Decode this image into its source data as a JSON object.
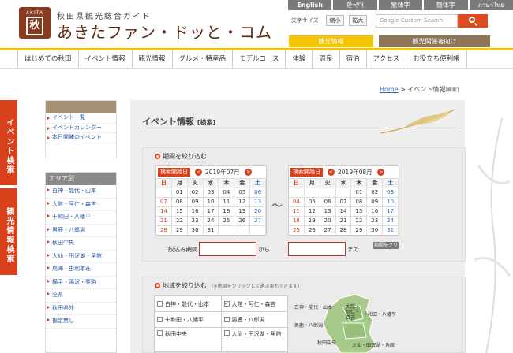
{
  "header": {
    "logo_text": "AKITA",
    "subtitle": "秋田県観光総合ガイド",
    "title": "あきたファン・ドッと・コム",
    "languages": [
      "English",
      "한국어",
      "繁体字",
      "簡体字",
      "ภาษาไทย"
    ],
    "font_size_label": "文字サイズ",
    "shrink_label": "縮小",
    "enlarge_label": "拡大",
    "search_placeholder": "Google Custom Search",
    "tab_tourism": "観光情報",
    "tab_business": "観光関係者向け"
  },
  "nav": {
    "items": [
      "はじめての秋田",
      "イベント情報",
      "観光情報",
      "グルメ・特産品",
      "モデルコース",
      "体験",
      "温泉",
      "宿泊",
      "アクセス",
      "お役立ち便利帳"
    ]
  },
  "breadcrumb": {
    "home": "Home",
    "sep": ">",
    "current": "イベント情報",
    "current_sub": "[検索]"
  },
  "side_tabs": {
    "event": "イベント検索",
    "sightseeing": "観光情報検索"
  },
  "sidebar": {
    "event_links": [
      "イベント一覧",
      "イベントカレンダー",
      "本日開催のイベント"
    ],
    "area_heading": "エリア別",
    "areas": [
      "白神・能代・山本",
      "大館・阿仁・森吉",
      "十和田・八幡平",
      "男鹿・八郎潟",
      "秋田中央",
      "大仙・田沢湖・角館",
      "鳥海・由利本荘",
      "横手・湯沢・栗駒",
      "全県",
      "秋田県外",
      "指定無し"
    ]
  },
  "main": {
    "title": "イベント情報",
    "title_sub": "[検索]",
    "period": {
      "heading": "期間を絞り込む",
      "tilde": "〜",
      "from_label": "絞込み期間",
      "from_suffix": "から",
      "to_suffix": "まで",
      "clear_label": "期間をクリア"
    },
    "calendars": [
      {
        "label": "検索開始日",
        "month": "2019年07月",
        "prev": "<",
        "next": ">",
        "weekdays": [
          "日",
          "月",
          "火",
          "水",
          "木",
          "金",
          "土"
        ],
        "weeks": [
          [
            "",
            "01",
            "02",
            "03",
            "04",
            "05",
            "06"
          ],
          [
            "07",
            "08",
            "09",
            "10",
            "11",
            "12",
            "13"
          ],
          [
            "14",
            "15",
            "16",
            "17",
            "18",
            "19",
            "20"
          ],
          [
            "21",
            "22",
            "23",
            "24",
            "25",
            "26",
            "27"
          ],
          [
            "28",
            "29",
            "30",
            "31",
            "",
            "",
            ""
          ]
        ]
      },
      {
        "label": "検索開始日",
        "month": "2019年08月",
        "prev": "<",
        "next": ">",
        "weekdays": [
          "日",
          "月",
          "火",
          "水",
          "木",
          "金",
          "土"
        ],
        "weeks": [
          [
            "",
            "",
            "",
            "",
            "01",
            "02",
            "03"
          ],
          [
            "04",
            "05",
            "06",
            "07",
            "08",
            "09",
            "10"
          ],
          [
            "11",
            "12",
            "13",
            "14",
            "15",
            "16",
            "17"
          ],
          [
            "18",
            "19",
            "20",
            "21",
            "22",
            "23",
            "24"
          ],
          [
            "25",
            "26",
            "27",
            "28",
            "29",
            "30",
            "31"
          ]
        ]
      }
    ],
    "area": {
      "heading": "地域を絞り込む",
      "note": "（※地図をクリックして選ぶ事もできます）",
      "options": [
        {
          "label": "白神・能代・山本",
          "checked": false
        },
        {
          "label": "大館・阿仁・森吉",
          "checked": true
        },
        {
          "label": "十和田・八幡平",
          "checked": false
        },
        {
          "label": "男鹿・八郎潟",
          "checked": false
        },
        {
          "label": "秋田中央",
          "checked": false
        },
        {
          "label": "大仙・田沢湖・角館",
          "checked": false
        }
      ],
      "map_labels": [
        "白神・能代・山本",
        "大館・阿仁・森吉",
        "十和田・八幡平",
        "男鹿・八郎潟",
        "秋田中央",
        "大仙・田沢湖・角館"
      ]
    }
  },
  "colors": {
    "accent_red": "#d9401c",
    "yellow": "#f5c400",
    "brown": "#8f7558",
    "map_green": "#a7c98a"
  }
}
